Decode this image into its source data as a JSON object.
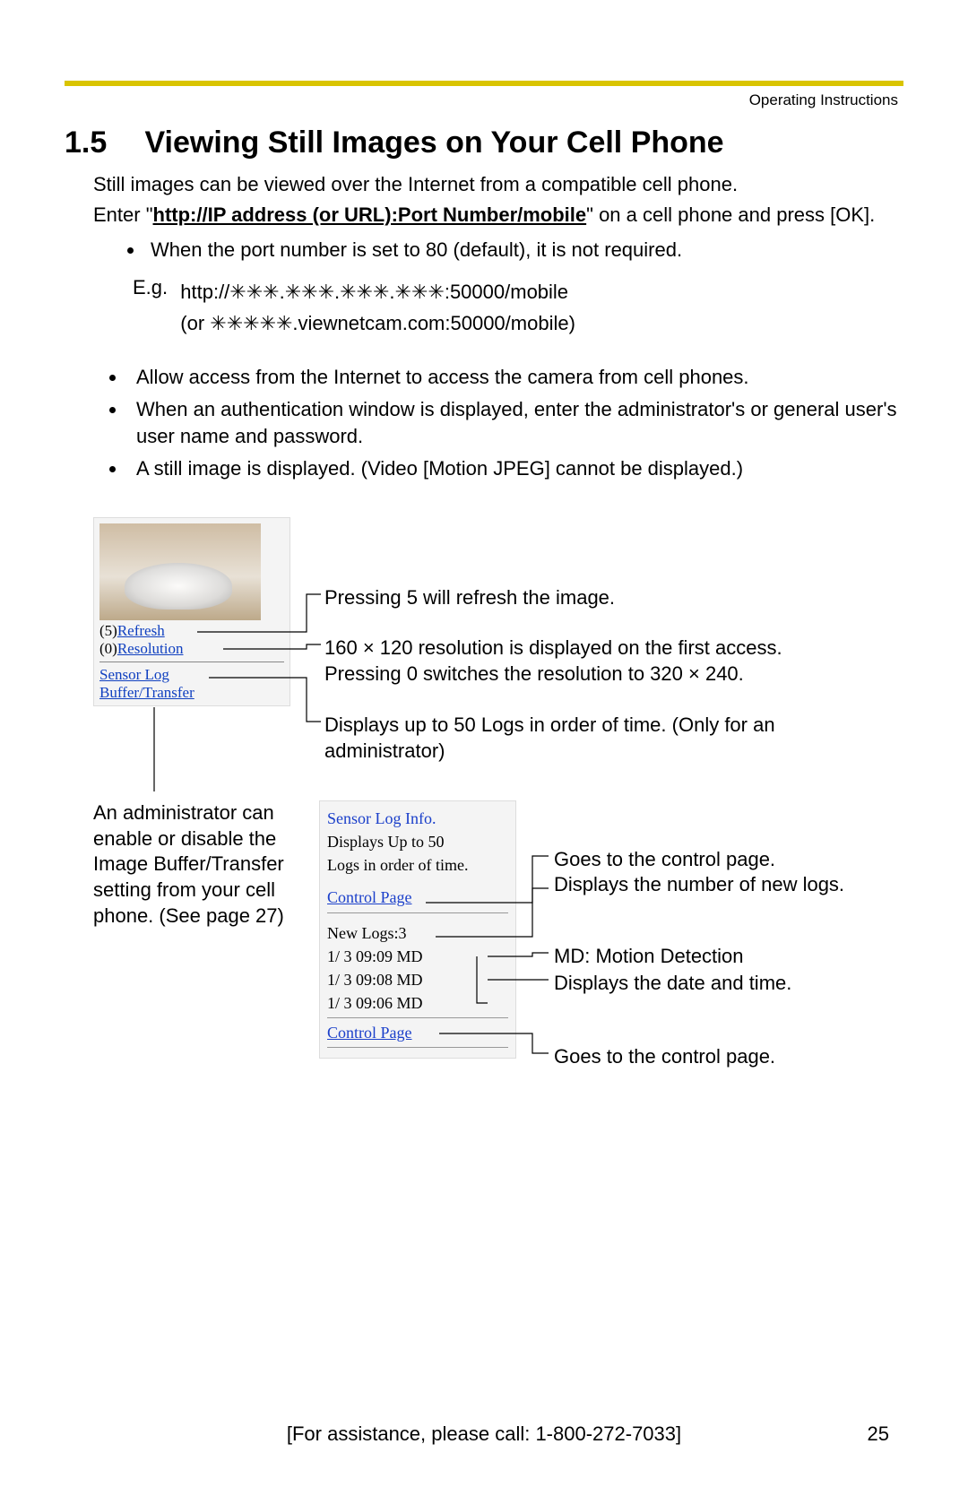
{
  "header": {
    "doc_label": "Operating Instructions"
  },
  "section": {
    "number": "1.5",
    "title": "Viewing Still Images on Your Cell Phone"
  },
  "intro": {
    "line1": "Still images can be viewed over the Internet from a compatible cell phone.",
    "line2_pre": "Enter \"",
    "line2_url": "http://IP address (or URL):Port Number/mobile",
    "line2_post": "\" on a cell phone and press [OK]."
  },
  "bullets_top": [
    "When the port number is set to 80 (default), it is not required."
  ],
  "example": {
    "label": "E.g.",
    "line1": "http://✳✳✳.✳✳✳.✳✳✳.✳✳✳:50000/mobile",
    "line2": "(or ✳✳✳✳✳.viewnetcam.com:50000/mobile)"
  },
  "bullets_main": [
    "Allow access from the Internet to access the camera from cell phones.",
    "When an authentication window is displayed, enter the administrator's or general user's user name and password.",
    "A still image is displayed. (Video [Motion JPEG] cannot be displayed.)"
  ],
  "phone_screen": {
    "refresh_prefix": "(5)",
    "refresh_label": "Refresh",
    "resolution_prefix": "(0)",
    "resolution_label": "Resolution",
    "sensor_log": "Sensor Log",
    "buffer_transfer": "Buffer/Transfer"
  },
  "callouts_phone": {
    "refresh": "Pressing 5 will refresh the image.",
    "resolution": "160 × 120 resolution is displayed on the first access. Pressing 0 switches the resolution to 320 × 240.",
    "sensor_log": "Displays up to 50 Logs in order of time. (Only for an administrator)"
  },
  "admin_note": "An administrator can enable or disable the Image Buffer/Transfer setting from your cell phone. (See page 27)",
  "log_screen": {
    "title": "Sensor Log Info.",
    "desc1": "Displays Up to 50",
    "desc2": "Logs in order of time.",
    "control_page": "Control Page",
    "new_logs_label": "New Logs:3",
    "rows": [
      "1/ 3 09:09   MD",
      "1/ 3 09:08   MD",
      "1/ 3 09:06   MD"
    ],
    "control_page2": "Control Page"
  },
  "callouts_log": {
    "control_top": "Goes to the control page.",
    "new_logs": "Displays the number of new logs.",
    "md": "MD: Motion Detection",
    "datetime": "Displays the date and time.",
    "control_bottom": "Goes to the control page."
  },
  "footer": {
    "assist": "[For assistance, please call: 1-800-272-7033]",
    "page": "25"
  }
}
